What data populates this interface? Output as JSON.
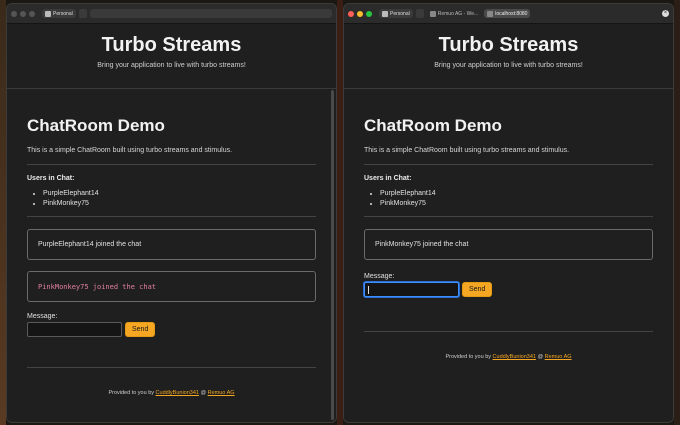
{
  "browser_left": {
    "profile": "Personal",
    "tab_active": "",
    "address": ""
  },
  "browser_right": {
    "profile": "Personal",
    "tab_other": "Remuo AG - We...",
    "tab_active": "localhost:8080"
  },
  "site": {
    "title": "Turbo Streams",
    "tagline": "Bring your application to live with turbo streams!"
  },
  "chat": {
    "title": "ChatRoom Demo",
    "intro": "This is a simple ChatRoom built using turbo streams and stimulus.",
    "users_title": "Users in Chat:",
    "users": [
      "PurpleElephant14",
      "PinkMonkey75"
    ],
    "message_label": "Message:",
    "send_label": "Send"
  },
  "left_messages": [
    "PurpleElephant14 joined the chat",
    "PinkMonkey75 joined the chat"
  ],
  "right_messages": [
    "PinkMonkey75 joined the chat"
  ],
  "footer": {
    "prefix": "Provided to you by",
    "author": "CuddlyBunion341",
    "sep": "@",
    "company": "Remuo AG"
  },
  "colors": {
    "accent": "#f5a623",
    "highlight_message": "#e57ea5",
    "focus_ring": "#3b8fff"
  }
}
